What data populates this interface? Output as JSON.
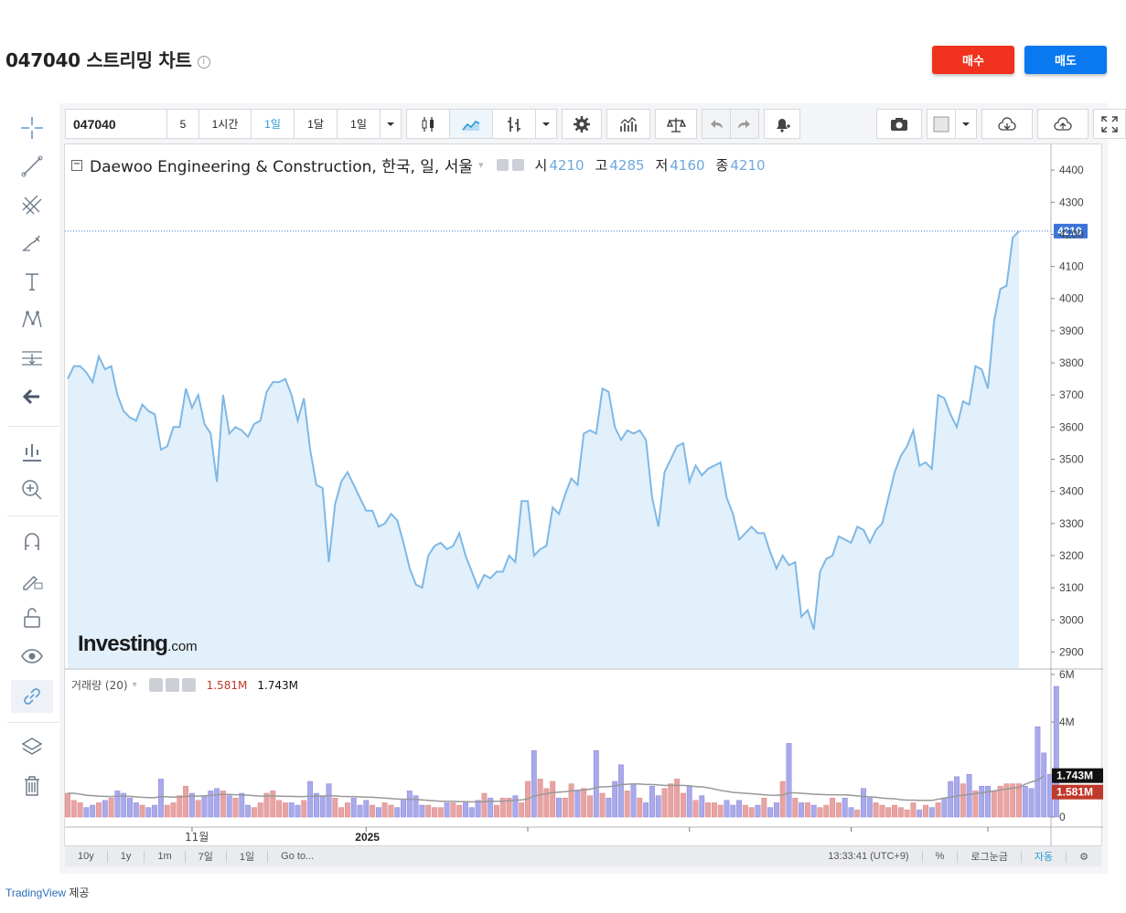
{
  "header": {
    "title": "047040 스트리밍 차트",
    "info_glyph": "i",
    "buy_label": "매수",
    "sell_label": "매도"
  },
  "toolbar": {
    "symbol": "047040",
    "intervals": [
      "5",
      "1시간",
      "1일",
      "1달",
      "1일"
    ],
    "selected_interval": "1일"
  },
  "legend": {
    "name": "Daewoo Engineering & Construction, 한국, 일, 서울",
    "open_label": "시",
    "open": "4210",
    "high_label": "고",
    "high": "4285",
    "low_label": "저",
    "low": "4160",
    "close_label": "종",
    "close": "4210"
  },
  "volume_legend": {
    "name": "거래량 (20)",
    "volume": "1.581M",
    "ma": "1.743M"
  },
  "watermark": {
    "brand": "Investing",
    "suffix": ".com"
  },
  "bottom_bar": {
    "ranges": [
      "10y",
      "1y",
      "1m",
      "7일",
      "1일",
      "Go to..."
    ],
    "time": "13:33:41 (UTC+9)",
    "percent": "%",
    "log": "로그눈금",
    "auto": "자동"
  },
  "footer": {
    "provider": "TradingView",
    "suffix": " 제공"
  },
  "colors": {
    "line": "#7fb8e6",
    "area": "#e1f0fa",
    "vol_up": "#e8a3a3",
    "vol_down": "#a9a9ec",
    "ma": "#999999",
    "price_tag": "#3b74d9"
  },
  "chart_data": [
    {
      "type": "area",
      "title": "Daewoo Engineering & Construction, 한국, 일, 서울",
      "ylim": [
        2850,
        4480
      ],
      "yticks": [
        2900,
        3000,
        3100,
        3200,
        3300,
        3400,
        3500,
        3600,
        3700,
        3800,
        3900,
        4000,
        4100,
        4200,
        4300,
        4400
      ],
      "xtick_labels": [
        "11월",
        "2025"
      ],
      "last_price": "4210",
      "values": [
        3750,
        3790,
        3790,
        3770,
        3740,
        3820,
        3780,
        3790,
        3700,
        3650,
        3630,
        3620,
        3670,
        3650,
        3640,
        3530,
        3540,
        3600,
        3600,
        3720,
        3660,
        3700,
        3610,
        3580,
        3430,
        3700,
        3580,
        3600,
        3590,
        3570,
        3610,
        3620,
        3710,
        3740,
        3740,
        3750,
        3700,
        3620,
        3690,
        3530,
        3420,
        3410,
        3180,
        3360,
        3430,
        3460,
        3420,
        3380,
        3340,
        3340,
        3290,
        3300,
        3330,
        3310,
        3240,
        3160,
        3110,
        3100,
        3200,
        3230,
        3240,
        3220,
        3230,
        3270,
        3200,
        3150,
        3100,
        3140,
        3130,
        3150,
        3150,
        3200,
        3180,
        3370,
        3370,
        3200,
        3220,
        3230,
        3350,
        3330,
        3390,
        3440,
        3420,
        3580,
        3590,
        3580,
        3720,
        3710,
        3600,
        3560,
        3590,
        3580,
        3590,
        3560,
        3380,
        3290,
        3460,
        3500,
        3540,
        3550,
        3430,
        3480,
        3450,
        3470,
        3480,
        3490,
        3380,
        3330,
        3250,
        3270,
        3290,
        3270,
        3270,
        3210,
        3160,
        3200,
        3170,
        3180,
        3010,
        3030,
        2970,
        3150,
        3190,
        3200,
        3260,
        3250,
        3240,
        3290,
        3280,
        3240,
        3280,
        3300,
        3380,
        3460,
        3510,
        3540,
        3590,
        3480,
        3490,
        3470,
        3700,
        3690,
        3640,
        3600,
        3680,
        3670,
        3790,
        3780,
        3720,
        3930,
        4030,
        4040,
        4190,
        4210
      ]
    },
    {
      "type": "bar",
      "title": "거래량 (20)",
      "ylim": [
        0,
        6
      ],
      "yticks_labels": [
        "0",
        "4M",
        "6M"
      ],
      "values": [
        1.0,
        0.7,
        0.6,
        0.4,
        0.5,
        0.6,
        0.7,
        0.8,
        1.1,
        1.0,
        0.8,
        0.6,
        0.5,
        0.4,
        0.5,
        1.6,
        0.5,
        0.6,
        0.9,
        1.3,
        1.0,
        0.7,
        0.9,
        1.1,
        1.2,
        1.1,
        0.9,
        0.8,
        1.0,
        0.5,
        0.4,
        0.6,
        1.0,
        1.1,
        0.7,
        0.6,
        0.6,
        0.5,
        0.7,
        1.5,
        1.0,
        0.9,
        1.4,
        0.8,
        0.4,
        0.6,
        0.8,
        0.5,
        0.7,
        0.5,
        0.4,
        0.6,
        0.5,
        0.4,
        0.7,
        1.1,
        0.9,
        0.5,
        0.5,
        0.4,
        0.4,
        0.6,
        0.6,
        0.5,
        0.6,
        0.4,
        0.7,
        1.0,
        0.8,
        0.5,
        0.8,
        0.8,
        0.9,
        0.6,
        1.5,
        2.8,
        1.6,
        1.2,
        1.5,
        0.8,
        0.8,
        1.4,
        1.1,
        1.2,
        0.9,
        2.8,
        1.0,
        0.8,
        1.5,
        2.2,
        1.1,
        1.4,
        0.8,
        0.6,
        1.3,
        0.9,
        1.2,
        1.4,
        1.6,
        1.0,
        1.3,
        0.7,
        0.9,
        0.6,
        0.6,
        0.5,
        0.7,
        0.5,
        0.7,
        0.5,
        0.4,
        0.5,
        0.8,
        0.4,
        0.6,
        1.5,
        3.1,
        0.8,
        0.6,
        0.6,
        0.5,
        0.4,
        0.5,
        0.8,
        0.6,
        0.8,
        0.4,
        0.3,
        1.2,
        0.8,
        0.6,
        0.5,
        0.4,
        0.5,
        0.4,
        0.3,
        0.6,
        0.3,
        0.5,
        0.4,
        0.6,
        0.8,
        1.5,
        1.7,
        1.4,
        1.8,
        1.1,
        1.3,
        1.3,
        1.1,
        1.3,
        1.4,
        1.4,
        1.4,
        1.3,
        1.2,
        3.8,
        2.7,
        1.8,
        5.5
      ],
      "moving_average": [
        1.0,
        1.0,
        0.96,
        0.92,
        0.9,
        0.88,
        0.87,
        0.86,
        0.88,
        0.88,
        0.87,
        0.85,
        0.83,
        0.82,
        0.82,
        0.86,
        0.85,
        0.84,
        0.85,
        0.87,
        0.88,
        0.88,
        0.89,
        0.91,
        0.94,
        0.95,
        0.95,
        0.94,
        0.94,
        0.92,
        0.9,
        0.88,
        0.88,
        0.89,
        0.88,
        0.87,
        0.87,
        0.86,
        0.86,
        0.88,
        0.88,
        0.88,
        0.9,
        0.89,
        0.87,
        0.86,
        0.86,
        0.85,
        0.84,
        0.83,
        0.81,
        0.8,
        0.78,
        0.76,
        0.75,
        0.75,
        0.74,
        0.72,
        0.7,
        0.68,
        0.66,
        0.66,
        0.66,
        0.65,
        0.65,
        0.64,
        0.64,
        0.65,
        0.66,
        0.66,
        0.67,
        0.69,
        0.71,
        0.72,
        0.77,
        0.88,
        0.94,
        0.98,
        1.03,
        1.05,
        1.07,
        1.1,
        1.12,
        1.15,
        1.17,
        1.25,
        1.27,
        1.28,
        1.31,
        1.36,
        1.38,
        1.4,
        1.39,
        1.37,
        1.37,
        1.35,
        1.33,
        1.33,
        1.33,
        1.33,
        1.32,
        1.28,
        1.27,
        1.23,
        1.18,
        1.12,
        1.08,
        1.04,
        1.02,
        1.0,
        0.98,
        0.96,
        0.94,
        0.92,
        0.91,
        0.93,
        1.02,
        1.02,
        1.0,
        0.98,
        0.96,
        0.95,
        0.94,
        0.94,
        0.93,
        0.93,
        0.91,
        0.89,
        0.86,
        0.85,
        0.83,
        0.8,
        0.78,
        0.77,
        0.73,
        0.71,
        0.71,
        0.7,
        0.7,
        0.7,
        0.75,
        0.8,
        0.84,
        0.89,
        0.92,
        0.95,
        0.99,
        1.02,
        1.06,
        1.1,
        1.14,
        1.18,
        1.22,
        1.25,
        1.38,
        1.48,
        1.54,
        1.74
      ]
    }
  ]
}
